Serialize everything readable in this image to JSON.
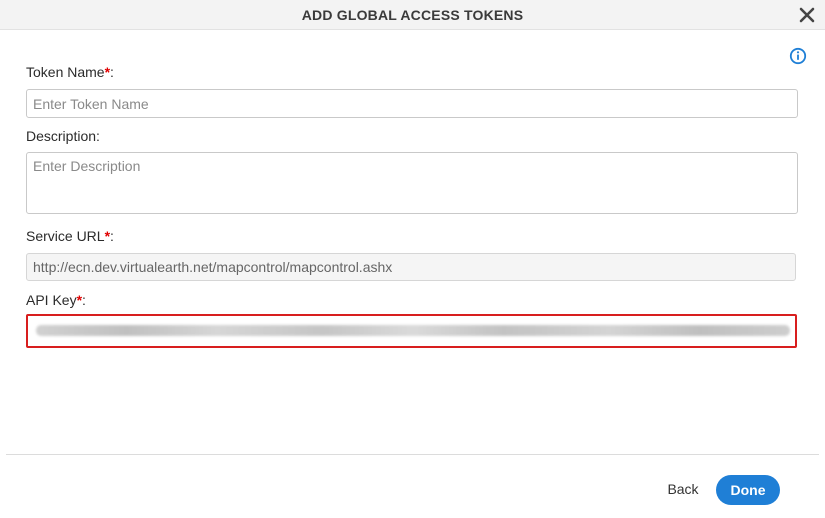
{
  "dialog": {
    "title": "ADD GLOBAL ACCESS TOKENS",
    "close_icon": "close-icon",
    "info_icon": "info-icon"
  },
  "form": {
    "token_name": {
      "label": "Token Name",
      "required_mark": "*",
      "suffix": ":",
      "placeholder": "Enter Token Name",
      "value": ""
    },
    "description": {
      "label": "Description:",
      "placeholder": "Enter Description",
      "value": ""
    },
    "service_url": {
      "label": "Service URL",
      "required_mark": "*",
      "suffix": ":",
      "value": "http://ecn.dev.virtualearth.net/mapcontrol/mapcontrol.ashx"
    },
    "api_key": {
      "label": "API Key",
      "required_mark": "*",
      "suffix": ":"
    }
  },
  "footer": {
    "back_label": "Back",
    "done_label": "Done"
  },
  "colors": {
    "accent": "#1f7fd6",
    "required": "#e00000",
    "highlight_border": "#d81e1e"
  }
}
